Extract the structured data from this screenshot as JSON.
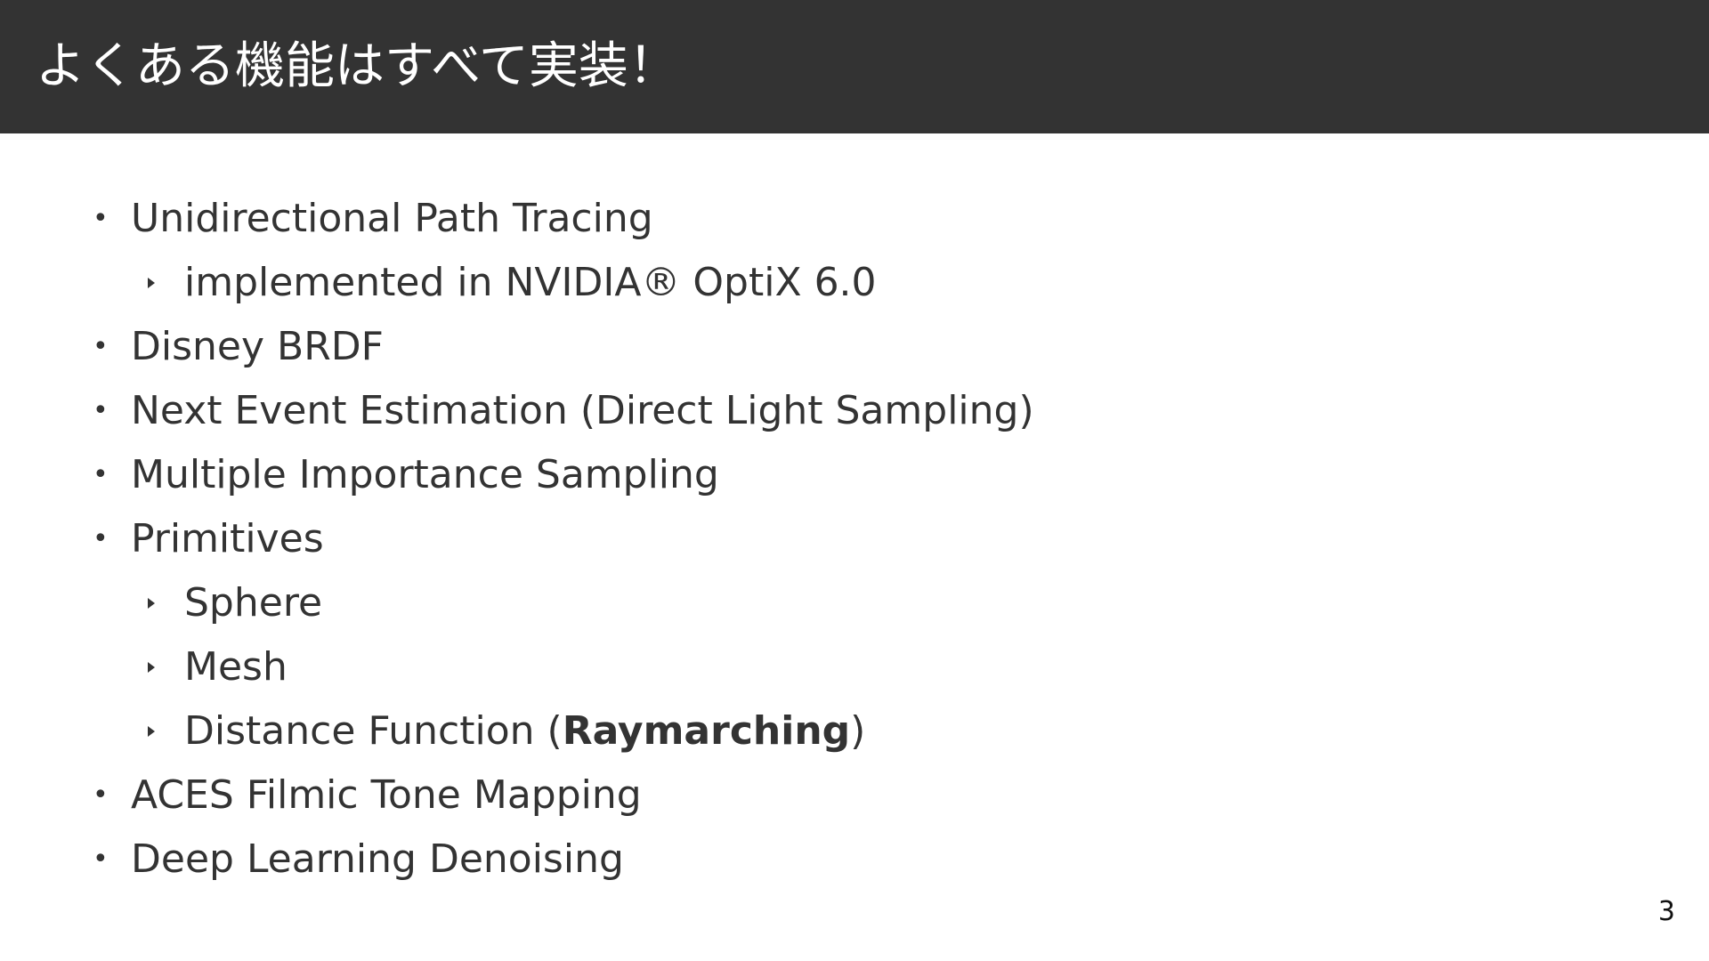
{
  "slide": {
    "title": "よくある機能はすべて実装！",
    "page_number": "3",
    "items": [
      {
        "text": "Unidirectional Path Tracing"
      },
      {
        "text": "implemented in NVIDIA® OptiX 6.0"
      },
      {
        "text": "Disney BRDF"
      },
      {
        "text": "Next Event Estimation (Direct Light Sampling)"
      },
      {
        "text": "Multiple Importance Sampling"
      },
      {
        "text": "Primitives"
      },
      {
        "text": "Sphere"
      },
      {
        "text": "Mesh"
      },
      {
        "text_before": "Distance Function (",
        "text_bold": "Raymarching",
        "text_after": ")"
      },
      {
        "text": "ACES Filmic Tone Mapping"
      },
      {
        "text": "Deep Learning Denoising"
      }
    ]
  },
  "colors": {
    "header_background": "#333333",
    "title_text": "#ffffff",
    "body_text": "#333333"
  }
}
